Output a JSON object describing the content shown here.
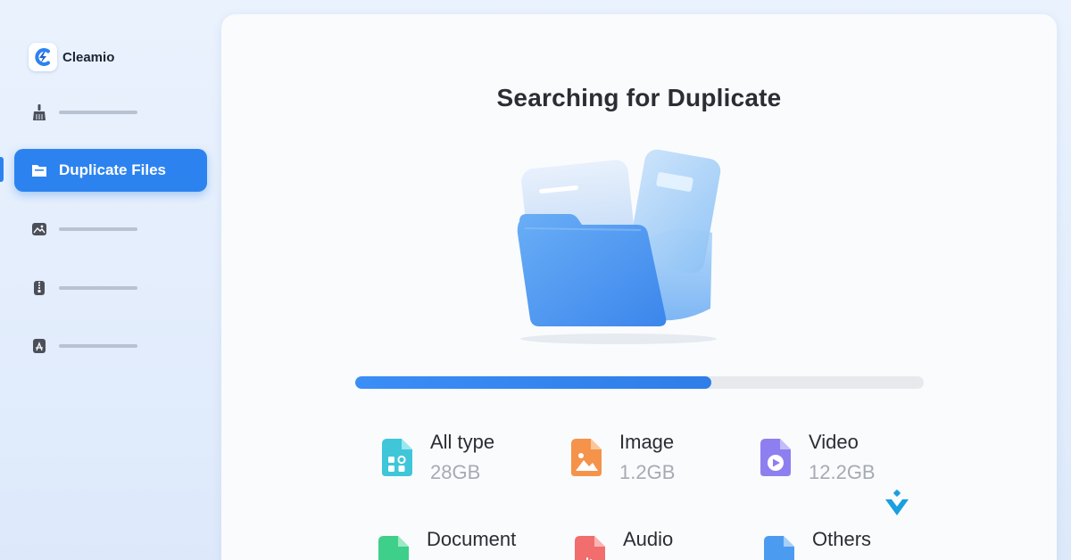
{
  "app": {
    "name": "Cleamio"
  },
  "sidebar": {
    "items": [
      {
        "icon": "broom-icon",
        "label": ""
      },
      {
        "icon": "folder-icon",
        "label": "Duplicate Files",
        "active": true
      },
      {
        "icon": "image-icon",
        "label": ""
      },
      {
        "icon": "archive-icon",
        "label": ""
      },
      {
        "icon": "pdf-icon",
        "label": ""
      }
    ]
  },
  "main": {
    "title": "Searching for Duplicate",
    "progress": 0.626,
    "categories": [
      {
        "name": "All type",
        "size": "28GB",
        "icon": "all-type-icon",
        "color": "#3fc6d8"
      },
      {
        "name": "Image",
        "size": "1.2GB",
        "icon": "image-file-icon",
        "color": "#f5934a"
      },
      {
        "name": "Video",
        "size": "12.2GB",
        "icon": "video-file-icon",
        "color": "#8d7ff0"
      },
      {
        "name": "Document",
        "size": "",
        "icon": "document-file-icon",
        "color": "#3ecf8a"
      },
      {
        "name": "Audio",
        "size": "",
        "icon": "audio-file-icon",
        "color": "#f26d6d"
      },
      {
        "name": "Others",
        "size": "",
        "icon": "others-file-icon",
        "color": "#4b9cf0"
      }
    ]
  },
  "colors": {
    "accent": "#2c83f0",
    "track": "#e8e9ec"
  }
}
